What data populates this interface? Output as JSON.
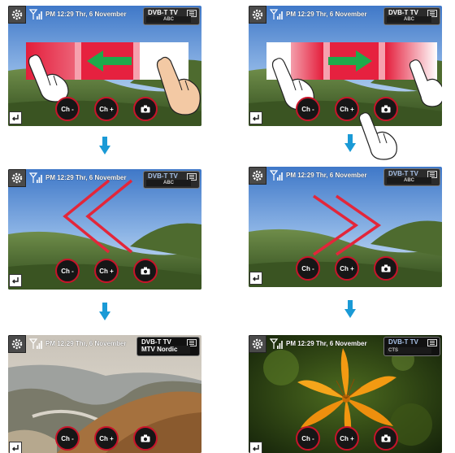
{
  "screens": [
    {
      "status": "PM 12:29 Thr, 6 November",
      "channel": "DVB-T TV",
      "sub": "ABC",
      "btn_minus": "Ch -",
      "btn_plus": "Ch +"
    },
    {
      "status": "PM 12:29 Thr, 6 November",
      "channel": "DVB-T TV",
      "sub": "ABC",
      "btn_minus": "Ch -",
      "btn_plus": "Ch +"
    },
    {
      "status": "PM 12:29 Thr, 6 November",
      "channel": "DVB-T TV",
      "sub": "ABC",
      "btn_minus": "Ch -",
      "btn_plus": "Ch +"
    },
    {
      "status": "PM 12:29 Thr, 6 November",
      "channel": "DVB-T TV",
      "sub": "ABC",
      "btn_minus": "Ch -",
      "btn_plus": "Ch +"
    },
    {
      "status": "PM 12:29 Thr, 6 November",
      "channel": "DVB-T TV",
      "sub": "MTV Nordic",
      "btn_minus": "Ch -",
      "btn_plus": "Ch +"
    },
    {
      "status": "PM 12:29 Thr, 6 November",
      "channel": "DVB-T TV",
      "sub": "CTS",
      "btn_minus": "Ch -",
      "btn_plus": "Ch +"
    }
  ],
  "icons": {
    "settings": "gear-icon",
    "signal": "signal-strength-icon",
    "menu": "menu-icon",
    "camera": "camera-icon",
    "back": "back-icon",
    "flow": "arrow-down-icon",
    "hand": "hand-pointer-icon"
  },
  "colors": {
    "accent_red": "#e3263a",
    "arrow_green": "#1faa4b",
    "flow_arrow": "#1a9ad6",
    "button_ring": "#c8142a"
  }
}
